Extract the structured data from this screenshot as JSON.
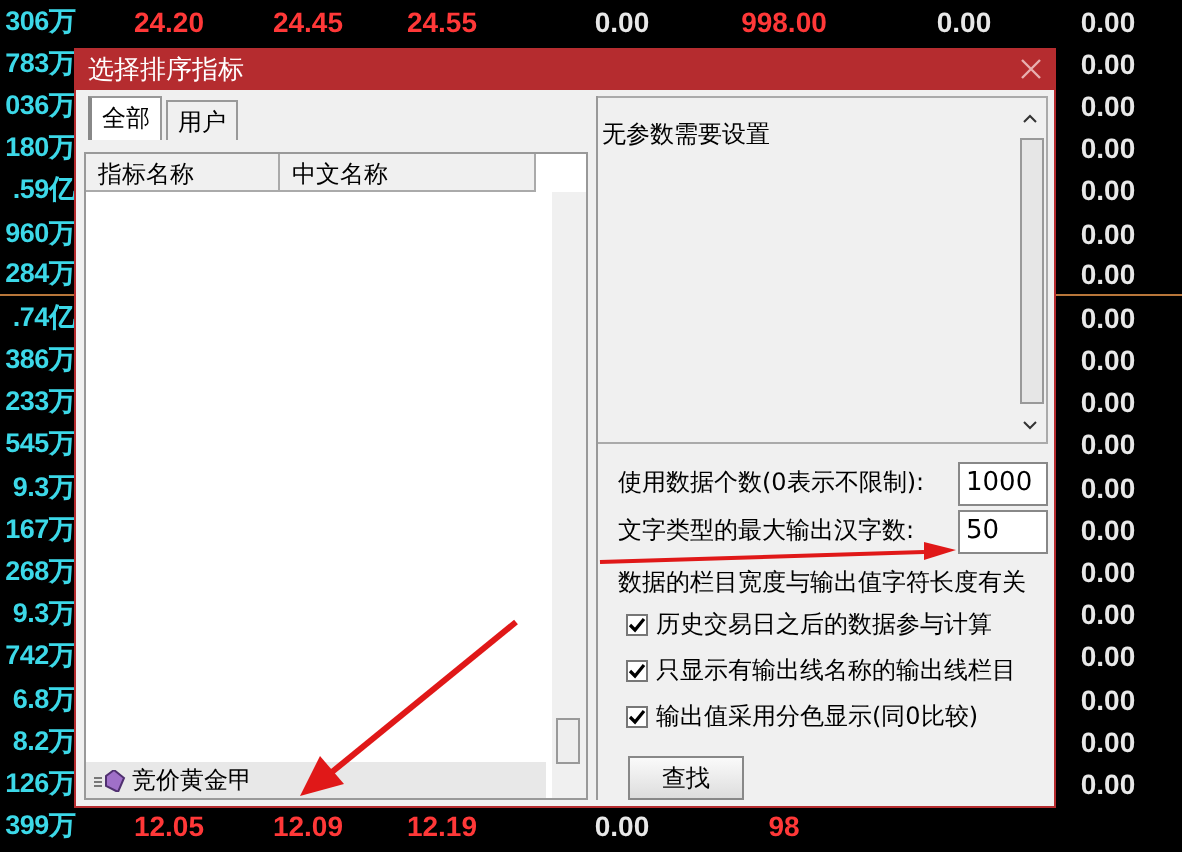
{
  "board": {
    "rows": [
      {
        "volume": "306万",
        "c1": "24.20",
        "c2": "24.45",
        "c3": "24.55",
        "c4": "0.00",
        "c5": "998.00",
        "c6": "0.00",
        "c7": "0.00"
      },
      {
        "volume": "783万",
        "c7": "0.00"
      },
      {
        "volume": "036万",
        "c7": "0.00"
      },
      {
        "volume": "180万",
        "c7": "0.00"
      },
      {
        "volume": ".59亿",
        "c7": "0.00"
      },
      {
        "volume": "960万",
        "c7": "0.00"
      },
      {
        "volume": "284万",
        "c7": "0.00"
      },
      {
        "volume": ".74亿",
        "c7": "0.00"
      },
      {
        "volume": "386万",
        "c7": "0.00"
      },
      {
        "volume": "233万",
        "c7": "0.00"
      },
      {
        "volume": "545万",
        "c7": "0.00"
      },
      {
        "volume": "9.3万",
        "c7": "0.00"
      },
      {
        "volume": "167万",
        "c7": "0.00"
      },
      {
        "volume": "268万",
        "c7": "0.00"
      },
      {
        "volume": "9.3万",
        "c7": "0.00"
      },
      {
        "volume": "742万",
        "c7": "0.00"
      },
      {
        "volume": "6.8万",
        "c7": "0.00"
      },
      {
        "volume": "8.2万",
        "c7": "0.00"
      },
      {
        "volume": "126万",
        "c7": "0.00"
      },
      {
        "volume": "399万",
        "c1": "12.05",
        "c2": "12.09",
        "c3": "12.19",
        "c4": "0.00",
        "c5": "98"
      }
    ]
  },
  "dialog": {
    "title": "选择排序指标",
    "tabs": [
      {
        "label": "全部",
        "selected": true
      },
      {
        "label": "用户",
        "selected": false
      }
    ],
    "list": {
      "columns": [
        "指标名称",
        "中文名称"
      ],
      "items": [
        {
          "label": "竞价黄金甲",
          "selected": true
        }
      ]
    },
    "params_text": "无参数需要设置",
    "fields": [
      {
        "label": "使用数据个数(0表示不限制):",
        "value": "1000"
      },
      {
        "label": "文字类型的最大输出汉字数:",
        "value": "50"
      }
    ],
    "note": "数据的栏目宽度与输出值字符长度有关",
    "checkboxes": [
      {
        "label": "历史交易日之后的数据参与计算",
        "checked": true
      },
      {
        "label": "只显示有输出线名称的输出线栏目",
        "checked": true
      },
      {
        "label": "输出值采用分色显示(同0比较)",
        "checked": true
      }
    ],
    "buttons": [
      "查找"
    ]
  }
}
